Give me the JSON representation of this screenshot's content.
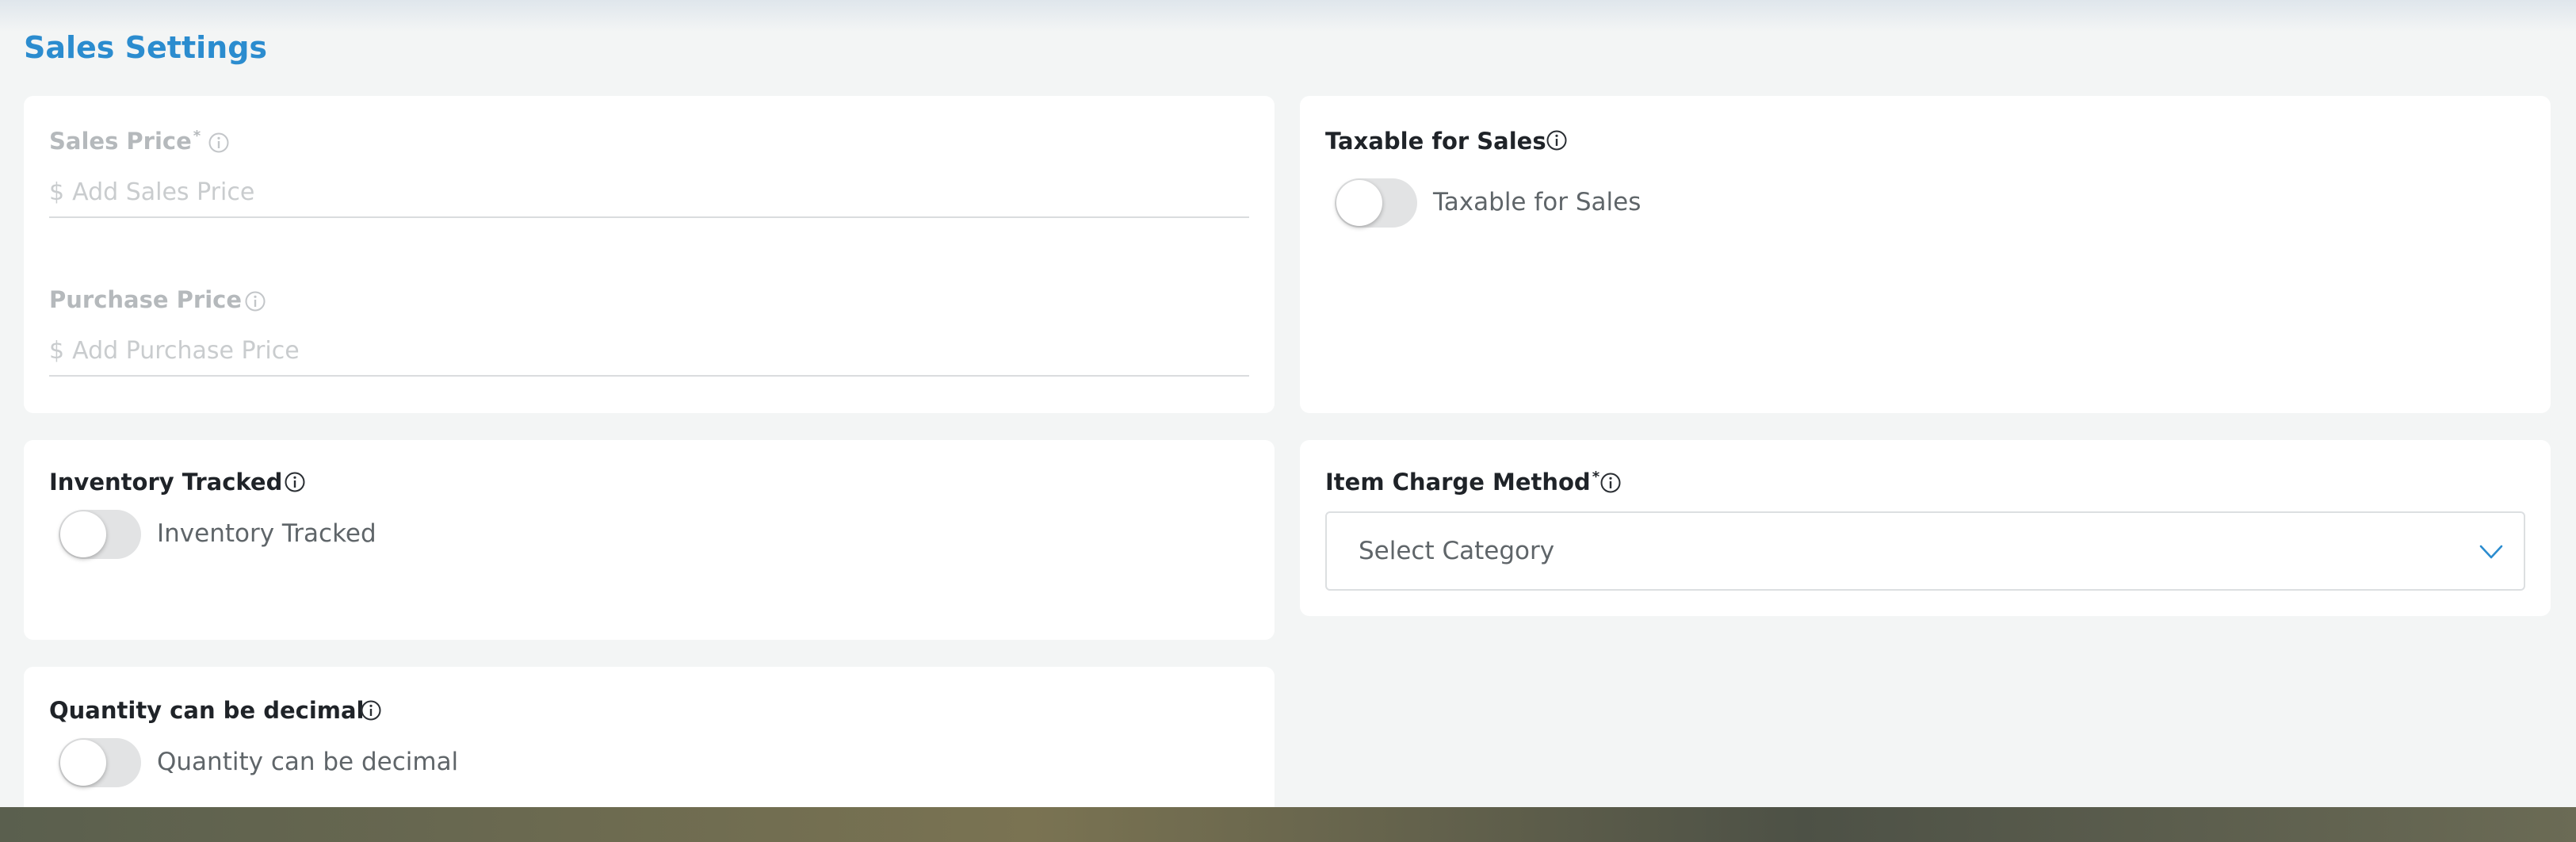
{
  "page": {
    "title": "Sales Settings"
  },
  "pricing": {
    "sales_price": {
      "label": "Sales Price",
      "required": "*",
      "currency": "$",
      "placeholder": "Add Sales Price"
    },
    "purchase_price": {
      "label": "Purchase Price",
      "currency": "$",
      "placeholder": "Add Purchase Price"
    }
  },
  "taxable": {
    "label": "Taxable for Sales",
    "toggle_label": "Taxable for Sales",
    "checked": false
  },
  "inventory": {
    "label": "Inventory Tracked",
    "toggle_label": "Inventory Tracked",
    "checked": false
  },
  "charge_method": {
    "label": "Item Charge Method",
    "required": "*",
    "selected": "Select Category"
  },
  "quantity_decimal": {
    "label": "Quantity can be decimal",
    "toggle_label": "Quantity can be decimal",
    "checked": false
  },
  "icons": {
    "info": "info-circle-icon",
    "chevron": "chevron-down-icon"
  },
  "colors": {
    "accent": "#2b8ccf",
    "background": "#f3f5f5",
    "card": "#ffffff",
    "toggle_off": "#e2e3e4"
  }
}
